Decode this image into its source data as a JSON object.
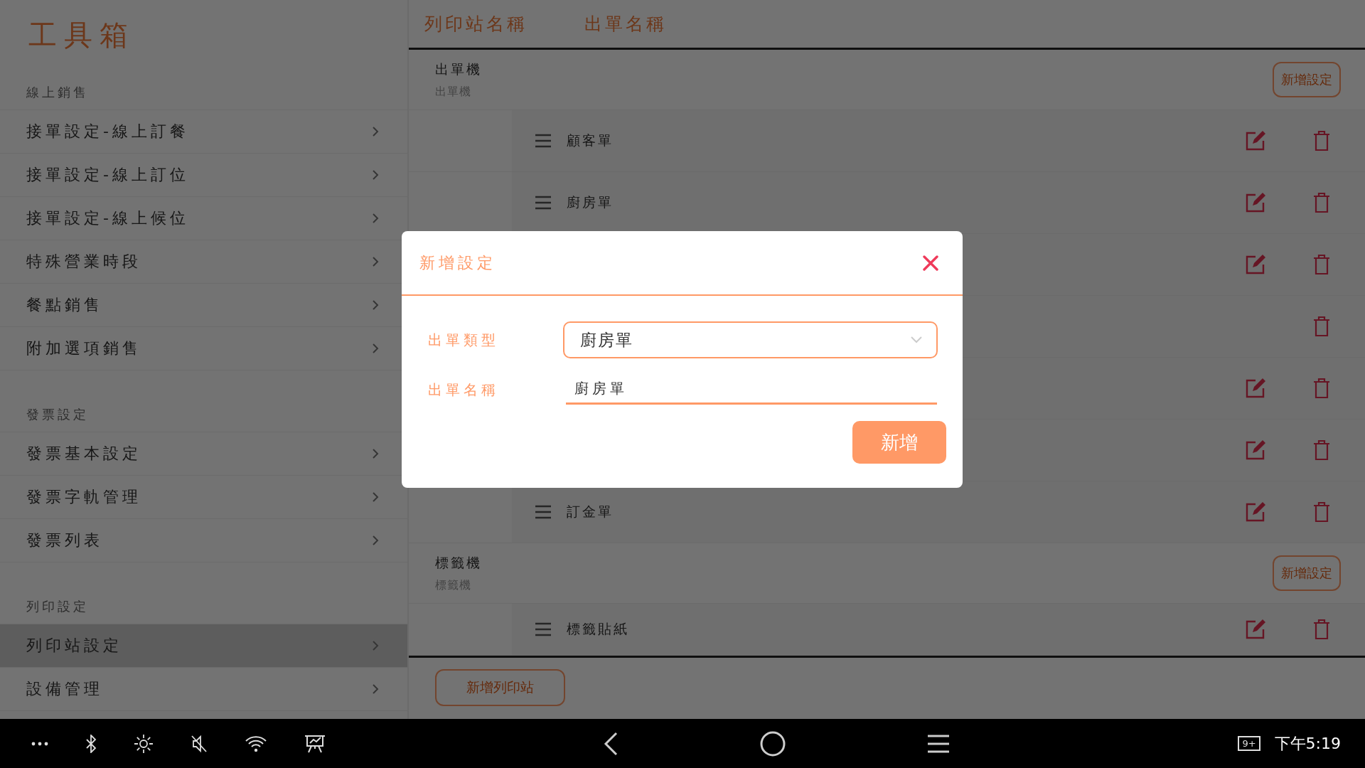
{
  "sidebar": {
    "title": "工具箱",
    "sections": [
      {
        "heading": "線上銷售",
        "items": [
          {
            "label": "接單設定-線上訂餐",
            "selected": false
          },
          {
            "label": "接單設定-線上訂位",
            "selected": false
          },
          {
            "label": "接單設定-線上候位",
            "selected": false
          },
          {
            "label": "特殊營業時段",
            "selected": false
          },
          {
            "label": "餐點銷售",
            "selected": false
          },
          {
            "label": "附加選項銷售",
            "selected": false
          }
        ]
      },
      {
        "heading": "發票設定",
        "items": [
          {
            "label": "發票基本設定",
            "selected": false
          },
          {
            "label": "發票字軌管理",
            "selected": false
          },
          {
            "label": "發票列表",
            "selected": false
          }
        ]
      },
      {
        "heading": "列印設定",
        "items": [
          {
            "label": "列印站設定",
            "selected": true
          },
          {
            "label": "設備管理",
            "selected": false
          }
        ]
      }
    ]
  },
  "table": {
    "columns": [
      "列印站名稱",
      "出單名稱"
    ],
    "stations": [
      {
        "name": "出單機",
        "subtitle": "出單機",
        "add_button": "新增設定",
        "items": [
          {
            "name": "顧客單",
            "editable": true
          },
          {
            "name": "廚房單",
            "editable": true
          },
          {
            "editable": true
          },
          {
            "editable": false
          },
          {
            "editable": true
          },
          {
            "editable": true
          },
          {
            "name": "訂金單",
            "editable": true
          }
        ]
      },
      {
        "name": "標籤機",
        "subtitle": "標籤機",
        "add_button": "新增設定",
        "items": [
          {
            "name": "標籤貼紙",
            "editable": true
          }
        ]
      }
    ]
  },
  "add_station_button": "新增列印站",
  "dialog": {
    "title": "新增設定",
    "fields": [
      {
        "kind": "select",
        "label": "出單類型",
        "value": "廚房單"
      },
      {
        "kind": "text",
        "label": "出單名稱",
        "value": "廚房單"
      }
    ],
    "submit": "新增"
  },
  "nav_bar": {
    "notification_badge": "9+",
    "time": "下午5:19"
  }
}
